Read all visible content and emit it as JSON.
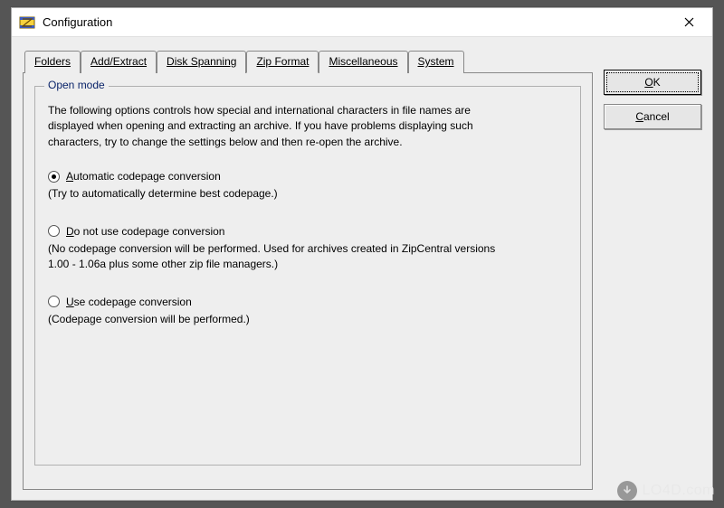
{
  "window": {
    "title": "Configuration"
  },
  "tabs": [
    {
      "label": "Folders",
      "accel_index": 0
    },
    {
      "label": "Add/Extract",
      "accel_index": 0
    },
    {
      "label": "Disk Spanning",
      "accel_index": 0
    },
    {
      "label": "Zip Format",
      "accel_index": 0
    },
    {
      "label": "Miscellaneous",
      "accel_index": 0
    },
    {
      "label": "System",
      "accel_index": 0
    }
  ],
  "active_tab_index": 3,
  "group": {
    "title": "Open mode",
    "description": "The following options controls how special and international characters in file names are displayed when opening and extracting an archive. If you have problems displaying such characters, try to change the settings below and then re-open the archive."
  },
  "options": [
    {
      "label_pre": "",
      "accel": "A",
      "label_post": "utomatic codepage conversion",
      "desc": "(Try to automatically determine best codepage.)",
      "checked": true
    },
    {
      "label_pre": "",
      "accel": "D",
      "label_post": "o not use codepage conversion",
      "desc": "(No codepage conversion will be performed. Used for archives created in ZipCentral versions 1.00 - 1.06a plus some other zip file managers.)",
      "checked": false
    },
    {
      "label_pre": "",
      "accel": "U",
      "label_post": "se codepage conversion",
      "desc": "(Codepage conversion will be performed.)",
      "checked": false
    }
  ],
  "buttons": {
    "ok_pre": "",
    "ok_accel": "O",
    "ok_post": "K",
    "cancel_pre": "",
    "cancel_accel": "C",
    "cancel_post": "ancel"
  },
  "watermark": "LO4D.com"
}
